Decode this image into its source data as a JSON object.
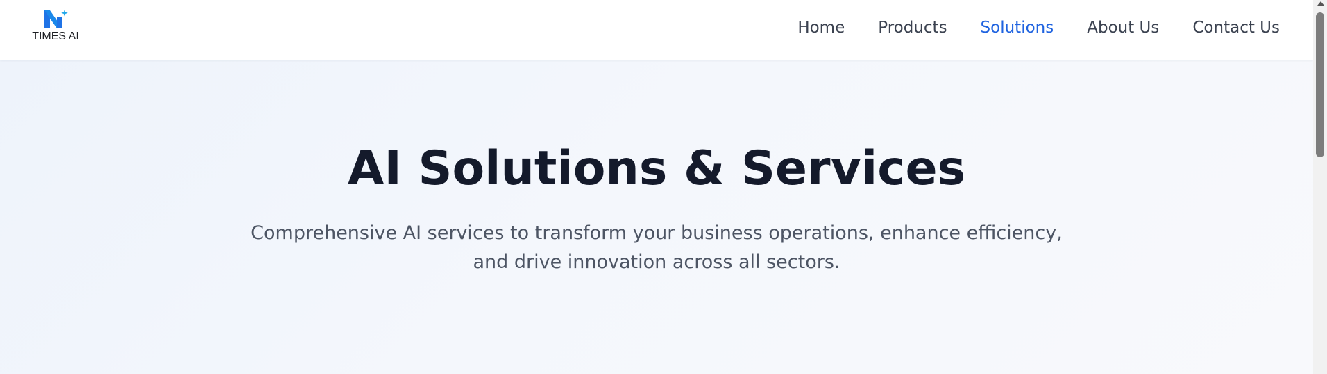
{
  "brand": {
    "name": "TIMES AI",
    "logo_icon": "times-ai-logo-icon",
    "colors": {
      "logo_primary": "#1f73e6",
      "logo_secondary": "#1ea7ea"
    }
  },
  "nav": {
    "items": [
      {
        "label": "Home",
        "active": false
      },
      {
        "label": "Products",
        "active": false
      },
      {
        "label": "Solutions",
        "active": true
      },
      {
        "label": "About Us",
        "active": false
      },
      {
        "label": "Contact Us",
        "active": false
      }
    ],
    "colors": {
      "default": "#3b4250",
      "active": "#1f63e0"
    }
  },
  "hero": {
    "title": "AI Solutions & Services",
    "subtitle_line1": "Comprehensive AI services to transform your business operations, enhance efficiency,",
    "subtitle_line2": "and drive innovation across all sectors."
  },
  "scrollbar": {
    "icons": [
      "scroll-up-arrow-icon"
    ]
  }
}
